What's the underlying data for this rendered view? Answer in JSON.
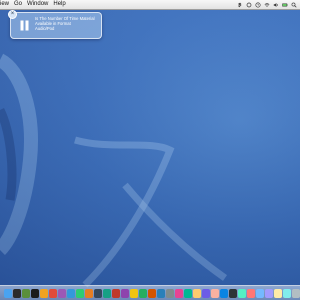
{
  "menubar": {
    "items": [
      "iew",
      "Go",
      "Window",
      "Help"
    ]
  },
  "notification": {
    "close_label": "×",
    "line1": "Is The Number Of Time Material",
    "line2": "Available in Format",
    "line3": "Audio/Pod"
  },
  "dock": {
    "icons": [
      {
        "name": "finder-icon",
        "color": "#4aa3f0"
      },
      {
        "name": "dashboard-icon",
        "color": "#2b2b2b"
      },
      {
        "name": "app-icon-2",
        "color": "#5a8f3c"
      },
      {
        "name": "app-icon-3",
        "color": "#1b1b1b"
      },
      {
        "name": "app-icon-4",
        "color": "#f0a321"
      },
      {
        "name": "app-icon-5",
        "color": "#e14b3a"
      },
      {
        "name": "app-icon-6",
        "color": "#9b59b6"
      },
      {
        "name": "app-icon-7",
        "color": "#3498db"
      },
      {
        "name": "app-icon-8",
        "color": "#2ecc71"
      },
      {
        "name": "app-icon-9",
        "color": "#e67e22"
      },
      {
        "name": "app-icon-10",
        "color": "#34495e"
      },
      {
        "name": "app-icon-11",
        "color": "#16a085"
      },
      {
        "name": "app-icon-12",
        "color": "#c0392b"
      },
      {
        "name": "app-icon-13",
        "color": "#8e44ad"
      },
      {
        "name": "app-icon-14",
        "color": "#f1c40f"
      },
      {
        "name": "app-icon-15",
        "color": "#27ae60"
      },
      {
        "name": "app-icon-16",
        "color": "#d35400"
      },
      {
        "name": "app-icon-17",
        "color": "#2980b9"
      },
      {
        "name": "app-icon-18",
        "color": "#7f8c8d"
      },
      {
        "name": "app-icon-19",
        "color": "#e84393"
      },
      {
        "name": "app-icon-20",
        "color": "#00b894"
      },
      {
        "name": "app-icon-21",
        "color": "#fdcb6e"
      },
      {
        "name": "app-icon-22",
        "color": "#6c5ce7"
      },
      {
        "name": "app-icon-23",
        "color": "#fab1a0"
      },
      {
        "name": "app-icon-24",
        "color": "#0984e3"
      },
      {
        "name": "app-icon-25",
        "color": "#2d3436"
      },
      {
        "name": "app-icon-26",
        "color": "#55efc4"
      },
      {
        "name": "app-icon-27",
        "color": "#ff7675"
      },
      {
        "name": "app-icon-28",
        "color": "#74b9ff"
      },
      {
        "name": "app-icon-29",
        "color": "#a29bfe"
      },
      {
        "name": "app-icon-30",
        "color": "#ffeaa7"
      },
      {
        "name": "app-icon-31",
        "color": "#81ecec"
      },
      {
        "name": "app-icon-32",
        "color": "#b2bec3"
      }
    ]
  }
}
